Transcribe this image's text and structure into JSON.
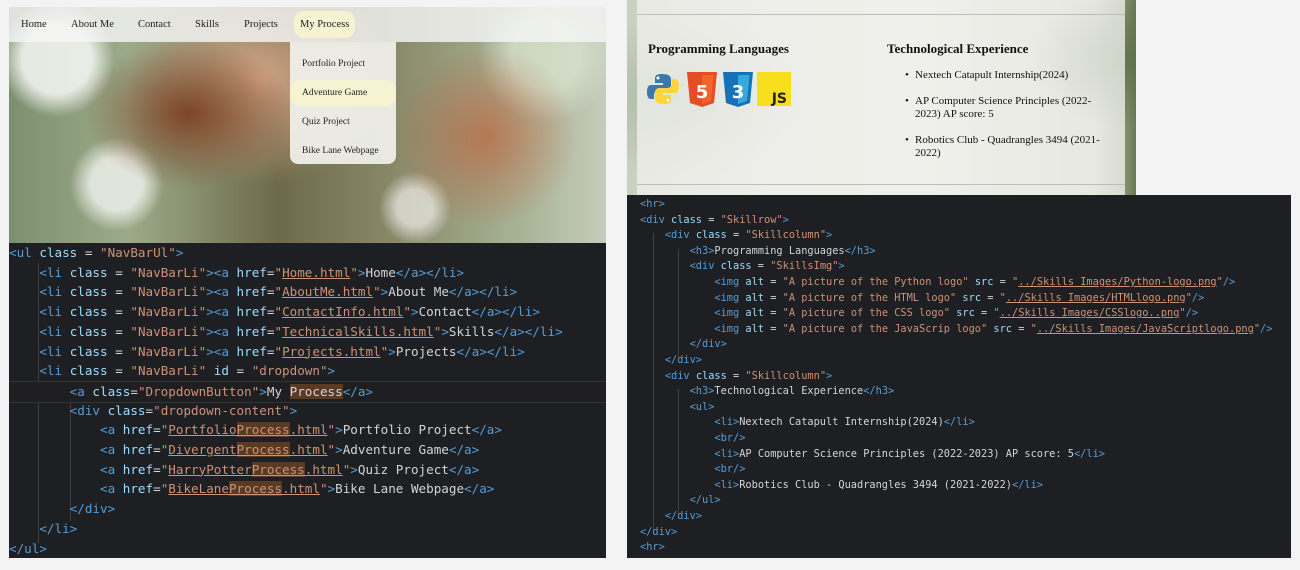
{
  "nav": {
    "items": [
      "Home",
      "About Me",
      "Contact",
      "Skills",
      "Projects",
      "My Process"
    ],
    "active": "My Process"
  },
  "dropdown": {
    "items": [
      "Portfolio Project",
      "Adventure Game",
      "Quiz Project",
      "Bike Lane Webpage"
    ],
    "highlighted": "Adventure Game"
  },
  "skills": {
    "programming_heading": "Programming Languages",
    "tech_heading": "Technological Experience",
    "experience": [
      "Nextech Catapult Internship(2024)",
      "AP Computer Science Principles (2022-2023) AP score: 5",
      "Robotics Club - Quadrangles 3494 (2021-2022)"
    ],
    "logos": [
      {
        "icon": "python-logo-icon",
        "label": ""
      },
      {
        "icon": "html5-logo-icon",
        "label": "5"
      },
      {
        "icon": "css3-logo-icon",
        "label": "3"
      },
      {
        "icon": "javascript-logo-icon",
        "label": "JS"
      }
    ]
  },
  "left_code": [
    [
      [
        "t",
        "<ul "
      ],
      [
        "a",
        "class"
      ],
      [
        "w",
        " = "
      ],
      [
        "s",
        "\"NavBarUl\""
      ],
      [
        "t",
        ">"
      ]
    ],
    [
      [
        "w",
        "    "
      ],
      [
        "t",
        "<li "
      ],
      [
        "a",
        "class"
      ],
      [
        "w",
        " = "
      ],
      [
        "s",
        "\"NavBarLi\""
      ],
      [
        "t",
        "><a "
      ],
      [
        "a",
        "href"
      ],
      [
        "w",
        "="
      ],
      [
        "s",
        "\""
      ],
      [
        "u",
        "Home.html"
      ],
      [
        "s",
        "\""
      ],
      [
        "t",
        ">"
      ],
      [
        "w",
        "Home"
      ],
      [
        "t",
        "</a></li>"
      ]
    ],
    [
      [
        "w",
        "    "
      ],
      [
        "t",
        "<li "
      ],
      [
        "a",
        "class"
      ],
      [
        "w",
        " = "
      ],
      [
        "s",
        "\"NavBarLi\""
      ],
      [
        "t",
        "><a "
      ],
      [
        "a",
        "href"
      ],
      [
        "w",
        "="
      ],
      [
        "s",
        "\""
      ],
      [
        "u",
        "AboutMe.html"
      ],
      [
        "s",
        "\""
      ],
      [
        "t",
        ">"
      ],
      [
        "w",
        "About Me"
      ],
      [
        "t",
        "</a></li>"
      ]
    ],
    [
      [
        "w",
        "    "
      ],
      [
        "t",
        "<li "
      ],
      [
        "a",
        "class"
      ],
      [
        "w",
        " = "
      ],
      [
        "s",
        "\"NavBarLi\""
      ],
      [
        "t",
        "><a "
      ],
      [
        "a",
        "href"
      ],
      [
        "w",
        "="
      ],
      [
        "s",
        "\""
      ],
      [
        "u",
        "ContactInfo.html"
      ],
      [
        "s",
        "\""
      ],
      [
        "t",
        ">"
      ],
      [
        "w",
        "Contact"
      ],
      [
        "t",
        "</a></li>"
      ]
    ],
    [
      [
        "w",
        "    "
      ],
      [
        "t",
        "<li "
      ],
      [
        "a",
        "class"
      ],
      [
        "w",
        " = "
      ],
      [
        "s",
        "\"NavBarLi\""
      ],
      [
        "t",
        "><a "
      ],
      [
        "a",
        "href"
      ],
      [
        "w",
        "="
      ],
      [
        "s",
        "\""
      ],
      [
        "u",
        "TechnicalSkills.html"
      ],
      [
        "s",
        "\""
      ],
      [
        "t",
        ">"
      ],
      [
        "w",
        "Skills"
      ],
      [
        "t",
        "</a></li>"
      ]
    ],
    [
      [
        "w",
        "    "
      ],
      [
        "t",
        "<li "
      ],
      [
        "a",
        "class"
      ],
      [
        "w",
        " = "
      ],
      [
        "s",
        "\"NavBarLi\""
      ],
      [
        "t",
        "><a "
      ],
      [
        "a",
        "href"
      ],
      [
        "w",
        "="
      ],
      [
        "s",
        "\""
      ],
      [
        "u",
        "Projects.html"
      ],
      [
        "s",
        "\""
      ],
      [
        "t",
        ">"
      ],
      [
        "w",
        "Projects"
      ],
      [
        "t",
        "</a></li>"
      ]
    ],
    [
      [
        "w",
        "    "
      ],
      [
        "t",
        "<li "
      ],
      [
        "a",
        "class"
      ],
      [
        "w",
        " = "
      ],
      [
        "s",
        "\"NavBarLi\""
      ],
      [
        "w",
        " "
      ],
      [
        "a",
        "id"
      ],
      [
        "w",
        " = "
      ],
      [
        "s",
        "\"dropdown\""
      ],
      [
        "t",
        ">"
      ]
    ],
    [
      [
        "w",
        "        "
      ],
      [
        "t",
        "<a "
      ],
      [
        "a",
        "class"
      ],
      [
        "w",
        "="
      ],
      [
        "s",
        "\"DropdownButton\""
      ],
      [
        "t",
        ">"
      ],
      [
        "w",
        "My "
      ],
      [
        "hlw",
        "Process"
      ],
      [
        "t",
        "</a>"
      ]
    ],
    [
      [
        "w",
        "        "
      ],
      [
        "t",
        "<div "
      ],
      [
        "a",
        "class"
      ],
      [
        "w",
        "="
      ],
      [
        "s",
        "\"dropdown-content\""
      ],
      [
        "t",
        ">"
      ]
    ],
    [
      [
        "w",
        "            "
      ],
      [
        "t",
        "<a "
      ],
      [
        "a",
        "href"
      ],
      [
        "w",
        "="
      ],
      [
        "s",
        "\""
      ],
      [
        "u",
        "Portfolio"
      ],
      [
        "uh",
        "Process"
      ],
      [
        "u",
        ".html"
      ],
      [
        "s",
        "\""
      ],
      [
        "t",
        ">"
      ],
      [
        "w",
        "Portfolio Project"
      ],
      [
        "t",
        "</a>"
      ]
    ],
    [
      [
        "w",
        "            "
      ],
      [
        "t",
        "<a "
      ],
      [
        "a",
        "href"
      ],
      [
        "w",
        "="
      ],
      [
        "s",
        "\""
      ],
      [
        "u",
        "Divergent"
      ],
      [
        "uh",
        "Process"
      ],
      [
        "u",
        ".html"
      ],
      [
        "s",
        "\""
      ],
      [
        "t",
        ">"
      ],
      [
        "w",
        "Adventure Game"
      ],
      [
        "t",
        "</a>"
      ]
    ],
    [
      [
        "w",
        "            "
      ],
      [
        "t",
        "<a "
      ],
      [
        "a",
        "href"
      ],
      [
        "w",
        "="
      ],
      [
        "s",
        "\""
      ],
      [
        "u",
        "HarryPotter"
      ],
      [
        "uh",
        "Process"
      ],
      [
        "u",
        ".html"
      ],
      [
        "s",
        "\""
      ],
      [
        "t",
        ">"
      ],
      [
        "w",
        "Quiz Project"
      ],
      [
        "t",
        "</a>"
      ]
    ],
    [
      [
        "w",
        "            "
      ],
      [
        "t",
        "<a "
      ],
      [
        "a",
        "href"
      ],
      [
        "w",
        "="
      ],
      [
        "s",
        "\""
      ],
      [
        "u",
        "BikeLane"
      ],
      [
        "uh",
        "Process"
      ],
      [
        "u",
        ".html"
      ],
      [
        "s",
        "\""
      ],
      [
        "t",
        ">"
      ],
      [
        "w",
        "Bike Lane Webpage"
      ],
      [
        "t",
        "</a>"
      ]
    ],
    [
      [
        "w",
        "        "
      ],
      [
        "t",
        "</div>"
      ]
    ],
    [
      [
        "w",
        "    "
      ],
      [
        "t",
        "</li>"
      ]
    ],
    [
      [
        "t",
        "</ul>"
      ]
    ]
  ],
  "right_code": [
    [
      [
        "t",
        "<hr>"
      ]
    ],
    [
      [
        "t",
        "<div "
      ],
      [
        "a",
        "class"
      ],
      [
        "w",
        " = "
      ],
      [
        "s",
        "\"Skillrow\""
      ],
      [
        "t",
        ">"
      ]
    ],
    [
      [
        "w",
        "    "
      ],
      [
        "t",
        "<div "
      ],
      [
        "a",
        "class"
      ],
      [
        "w",
        " = "
      ],
      [
        "s",
        "\"Skillcolumn\""
      ],
      [
        "t",
        ">"
      ]
    ],
    [
      [
        "w",
        "        "
      ],
      [
        "t",
        "<h3>"
      ],
      [
        "w",
        "Programming Languages"
      ],
      [
        "t",
        "</h3>"
      ]
    ],
    [
      [
        "w",
        "        "
      ],
      [
        "t",
        "<div "
      ],
      [
        "a",
        "class"
      ],
      [
        "w",
        " = "
      ],
      [
        "s",
        "\"SkillsImg\""
      ],
      [
        "t",
        ">"
      ]
    ],
    [
      [
        "w",
        "            "
      ],
      [
        "t",
        "<img "
      ],
      [
        "a",
        "alt"
      ],
      [
        "w",
        " = "
      ],
      [
        "s",
        "\"A picture of the Python logo\""
      ],
      [
        "w",
        " "
      ],
      [
        "a",
        "src"
      ],
      [
        "w",
        " = "
      ],
      [
        "s",
        "\""
      ],
      [
        "u",
        "../Skills Images/Python-logo.png"
      ],
      [
        "s",
        "\""
      ],
      [
        "t",
        "/>"
      ]
    ],
    [
      [
        "w",
        "            "
      ],
      [
        "t",
        "<img "
      ],
      [
        "a",
        "alt"
      ],
      [
        "w",
        " = "
      ],
      [
        "s",
        "\"A picture of the HTML logo\""
      ],
      [
        "w",
        " "
      ],
      [
        "a",
        "src"
      ],
      [
        "w",
        " = "
      ],
      [
        "s",
        "\""
      ],
      [
        "u",
        "../Skills Images/HTMLlogo.png"
      ],
      [
        "s",
        "\""
      ],
      [
        "t",
        "/>"
      ]
    ],
    [
      [
        "w",
        "            "
      ],
      [
        "t",
        "<img "
      ],
      [
        "a",
        "alt"
      ],
      [
        "w",
        " = "
      ],
      [
        "s",
        "\"A picture of the CSS logo\""
      ],
      [
        "w",
        " "
      ],
      [
        "a",
        "src"
      ],
      [
        "w",
        " = "
      ],
      [
        "s",
        "\""
      ],
      [
        "u",
        "../Skills Images/CSSlogo..png"
      ],
      [
        "s",
        "\""
      ],
      [
        "t",
        "/>"
      ]
    ],
    [
      [
        "w",
        "            "
      ],
      [
        "t",
        "<img "
      ],
      [
        "a",
        "alt"
      ],
      [
        "w",
        " = "
      ],
      [
        "s",
        "\"A picture of the JavaScrip logo\""
      ],
      [
        "w",
        " "
      ],
      [
        "a",
        "src"
      ],
      [
        "w",
        " = "
      ],
      [
        "s",
        "\""
      ],
      [
        "u",
        "../Skills Images/JavaScriptlogo.png"
      ],
      [
        "s",
        "\""
      ],
      [
        "t",
        "/>"
      ]
    ],
    [
      [
        "w",
        "        "
      ],
      [
        "t",
        "</div>"
      ]
    ],
    [
      [
        "w",
        "    "
      ],
      [
        "t",
        "</div>"
      ]
    ],
    [
      [
        "w",
        "    "
      ],
      [
        "t",
        "<div "
      ],
      [
        "a",
        "class"
      ],
      [
        "w",
        " = "
      ],
      [
        "s",
        "\"Skillcolumn\""
      ],
      [
        "t",
        ">"
      ]
    ],
    [
      [
        "w",
        "        "
      ],
      [
        "t",
        "<h3>"
      ],
      [
        "w",
        "Technological Experience"
      ],
      [
        "t",
        "</h3>"
      ]
    ],
    [
      [
        "w",
        "        "
      ],
      [
        "t",
        "<ul>"
      ]
    ],
    [
      [
        "w",
        "            "
      ],
      [
        "t",
        "<li>"
      ],
      [
        "w",
        "Nextech Catapult Internship(2024)"
      ],
      [
        "t",
        "</li>"
      ]
    ],
    [
      [
        "w",
        "            "
      ],
      [
        "t",
        "<br/>"
      ]
    ],
    [
      [
        "w",
        "            "
      ],
      [
        "t",
        "<li>"
      ],
      [
        "w",
        "AP Computer Science Principles (2022-2023) AP score: 5"
      ],
      [
        "t",
        "</li>"
      ]
    ],
    [
      [
        "w",
        "            "
      ],
      [
        "t",
        "<br/>"
      ]
    ],
    [
      [
        "w",
        "            "
      ],
      [
        "t",
        "<li>"
      ],
      [
        "w",
        "Robotics Club - Quadrangles 3494 (2021-2022)"
      ],
      [
        "t",
        "</li>"
      ]
    ],
    [
      [
        "w",
        "        "
      ],
      [
        "t",
        "</ul>"
      ]
    ],
    [
      [
        "w",
        "    "
      ],
      [
        "t",
        "</div>"
      ]
    ],
    [
      [
        "t",
        "</div>"
      ]
    ],
    [
      [
        "t",
        "<hr>"
      ]
    ]
  ]
}
